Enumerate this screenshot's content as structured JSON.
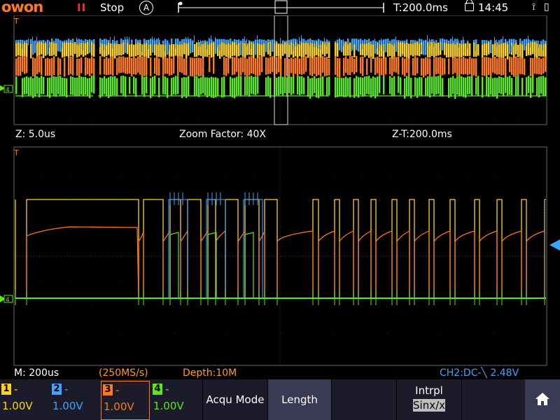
{
  "topbar": {
    "logo": "owon",
    "pause_symbol": "II",
    "run_state": "Stop",
    "trigger_mode": "A",
    "time_position": "T:200.0ms",
    "clock": "14:45",
    "usb_symbol": "⟟",
    "battery_symbol": "▯"
  },
  "zoom_info": {
    "zoom_time": "Z: 5.0us",
    "zoom_factor": "Zoom Factor: 40X",
    "zoom_trigger": "Z-T:200.0ms"
  },
  "status": {
    "timebase": "M: 200us",
    "sample_rate": "(250MS/s)",
    "depth": "Depth:10M",
    "trigger_info": "CH2:DC-╲ 2.48V"
  },
  "markers": {
    "trigger_mark": "T",
    "ground_mark": "4"
  },
  "channels": [
    {
      "num": "1",
      "dash": "-",
      "value": "1.00V",
      "color": "#ffd21a"
    },
    {
      "num": "2",
      "dash": "-",
      "value": "1.00V",
      "color": "#3fa4ff"
    },
    {
      "num": "3",
      "dash": "-",
      "value": "1.00V",
      "color": "#ff7a1a"
    },
    {
      "num": "4",
      "dash": "-",
      "value": "1.00V",
      "color": "#5de61a"
    }
  ],
  "menu": {
    "acqu_mode": "Acqu Mode",
    "length": "Length",
    "intrpl": "Intrpl",
    "intrpl_value": "Sinx/x"
  },
  "colors": {
    "ch1": "#ffd21a",
    "ch2": "#3fa4ff",
    "ch3": "#ff7a1a",
    "ch4": "#5de61a",
    "accent": "#ff7a1a"
  }
}
